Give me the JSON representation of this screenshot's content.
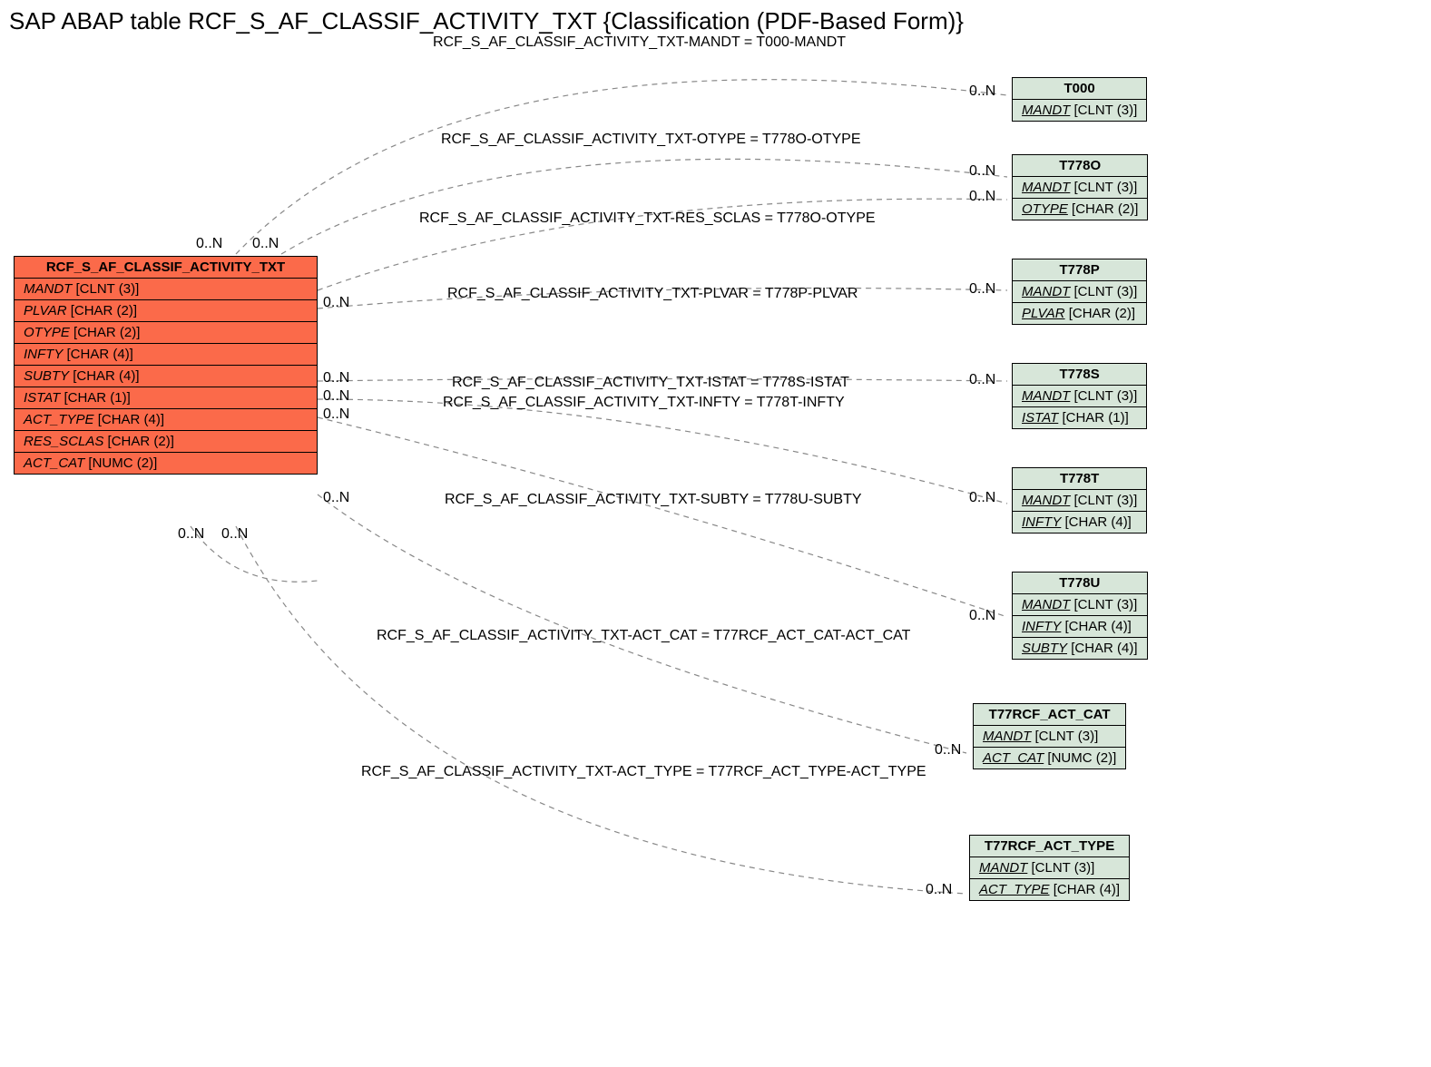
{
  "title": "SAP ABAP table RCF_S_AF_CLASSIF_ACTIVITY_TXT {Classification (PDF-Based Form)}",
  "main_entity": {
    "name": "RCF_S_AF_CLASSIF_ACTIVITY_TXT",
    "fields": [
      {
        "name": "MANDT",
        "type": "[CLNT (3)]",
        "key": false
      },
      {
        "name": "PLVAR",
        "type": "[CHAR (2)]",
        "key": false
      },
      {
        "name": "OTYPE",
        "type": "[CHAR (2)]",
        "key": false
      },
      {
        "name": "INFTY",
        "type": "[CHAR (4)]",
        "key": false
      },
      {
        "name": "SUBTY",
        "type": "[CHAR (4)]",
        "key": false
      },
      {
        "name": "ISTAT",
        "type": "[CHAR (1)]",
        "key": false
      },
      {
        "name": "ACT_TYPE",
        "type": "[CHAR (4)]",
        "key": false
      },
      {
        "name": "RES_SCLAS",
        "type": "[CHAR (2)]",
        "key": false
      },
      {
        "name": "ACT_CAT",
        "type": "[NUMC (2)]",
        "key": false
      }
    ]
  },
  "ref_entities": [
    {
      "name": "T000",
      "fields": [
        {
          "name": "MANDT",
          "type": "[CLNT (3)]",
          "key": true
        }
      ]
    },
    {
      "name": "T778O",
      "fields": [
        {
          "name": "MANDT",
          "type": "[CLNT (3)]",
          "key": true
        },
        {
          "name": "OTYPE",
          "type": "[CHAR (2)]",
          "key": true
        }
      ]
    },
    {
      "name": "T778P",
      "fields": [
        {
          "name": "MANDT",
          "type": "[CLNT (3)]",
          "key": true
        },
        {
          "name": "PLVAR",
          "type": "[CHAR (2)]",
          "key": true
        }
      ]
    },
    {
      "name": "T778S",
      "fields": [
        {
          "name": "MANDT",
          "type": "[CLNT (3)]",
          "key": true
        },
        {
          "name": "ISTAT",
          "type": "[CHAR (1)]",
          "key": true
        }
      ]
    },
    {
      "name": "T778T",
      "fields": [
        {
          "name": "MANDT",
          "type": "[CLNT (3)]",
          "key": true
        },
        {
          "name": "INFTY",
          "type": "[CHAR (4)]",
          "key": true
        }
      ]
    },
    {
      "name": "T778U",
      "fields": [
        {
          "name": "MANDT",
          "type": "[CLNT (3)]",
          "key": true
        },
        {
          "name": "INFTY",
          "type": "[CHAR (4)]",
          "key": true
        },
        {
          "name": "SUBTY",
          "type": "[CHAR (4)]",
          "key": true
        }
      ]
    },
    {
      "name": "T77RCF_ACT_CAT",
      "fields": [
        {
          "name": "MANDT",
          "type": "[CLNT (3)]",
          "key": true
        },
        {
          "name": "ACT_CAT",
          "type": "[NUMC (2)]",
          "key": true
        }
      ]
    },
    {
      "name": "T77RCF_ACT_TYPE",
      "fields": [
        {
          "name": "MANDT",
          "type": "[CLNT (3)]",
          "key": true
        },
        {
          "name": "ACT_TYPE",
          "type": "[CHAR (4)]",
          "key": true
        }
      ]
    }
  ],
  "relations": [
    {
      "label": "RCF_S_AF_CLASSIF_ACTIVITY_TXT-MANDT = T000-MANDT"
    },
    {
      "label": "RCF_S_AF_CLASSIF_ACTIVITY_TXT-OTYPE = T778O-OTYPE"
    },
    {
      "label": "RCF_S_AF_CLASSIF_ACTIVITY_TXT-RES_SCLAS = T778O-OTYPE"
    },
    {
      "label": "RCF_S_AF_CLASSIF_ACTIVITY_TXT-PLVAR = T778P-PLVAR"
    },
    {
      "label": "RCF_S_AF_CLASSIF_ACTIVITY_TXT-ISTAT = T778S-ISTAT"
    },
    {
      "label": "RCF_S_AF_CLASSIF_ACTIVITY_TXT-INFTY = T778T-INFTY"
    },
    {
      "label": "RCF_S_AF_CLASSIF_ACTIVITY_TXT-SUBTY = T778U-SUBTY"
    },
    {
      "label": "RCF_S_AF_CLASSIF_ACTIVITY_TXT-ACT_CAT = T77RCF_ACT_CAT-ACT_CAT"
    },
    {
      "label": "RCF_S_AF_CLASSIF_ACTIVITY_TXT-ACT_TYPE = T77RCF_ACT_TYPE-ACT_TYPE"
    }
  ],
  "cardinality": "0..N"
}
